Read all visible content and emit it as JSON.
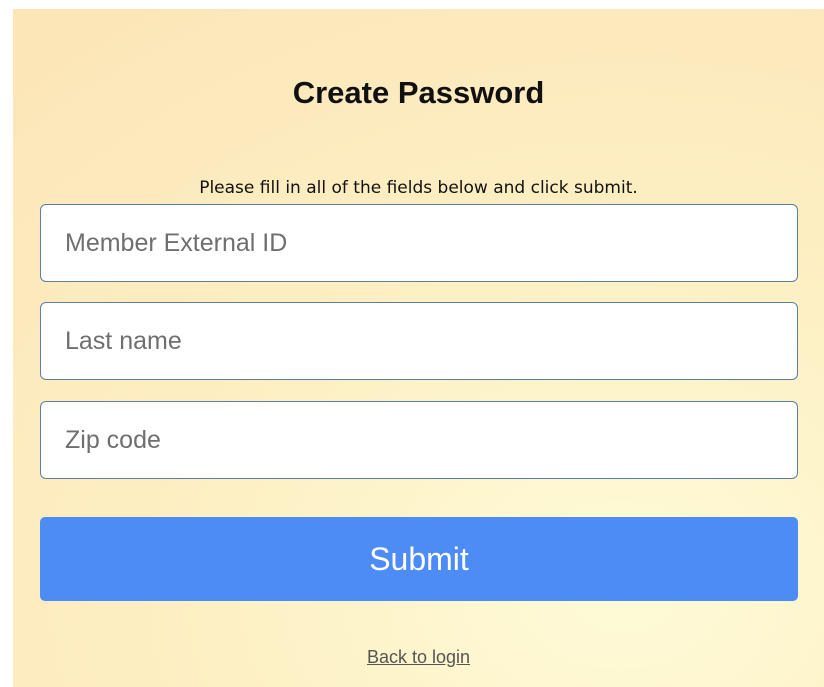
{
  "form": {
    "title": "Create Password",
    "instructions": "Please fill in all of the fields below and click submit.",
    "fields": [
      {
        "placeholder": "Member External ID",
        "value": ""
      },
      {
        "placeholder": "Last name",
        "value": ""
      },
      {
        "placeholder": "Zip code",
        "value": ""
      }
    ],
    "submit_label": "Submit",
    "back_link": "Back to login"
  },
  "colors": {
    "background": "#fce6b8",
    "submit_button": "#4d8cf5",
    "field_border": "#5d7fa6"
  }
}
